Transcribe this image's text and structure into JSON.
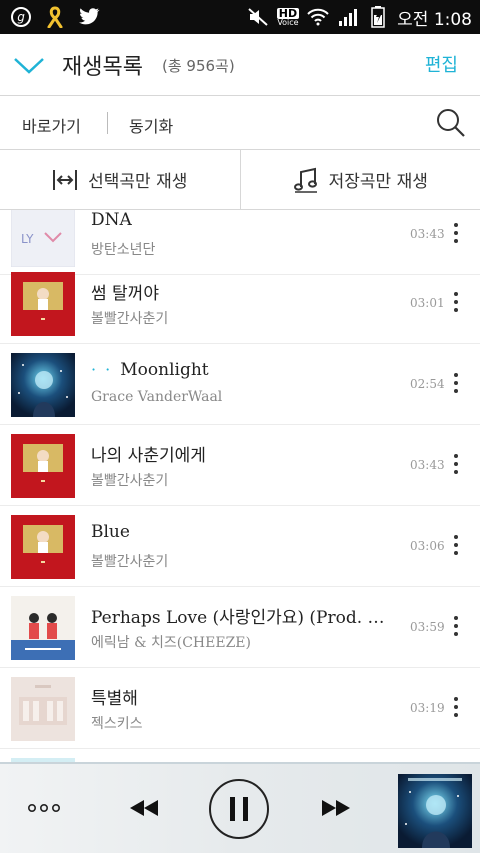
{
  "status_bar": {
    "icons": [
      "g-circle-icon",
      "yellow-ribbon-icon",
      "twitter-icon",
      "mute-icon",
      "hd-voice-icon",
      "wifi-icon",
      "signal-icon",
      "battery-icon"
    ],
    "hd": "HD",
    "voice": "Voice",
    "time": "오전 1:08"
  },
  "header": {
    "title": "재생목록",
    "count": "(총 956곡)",
    "edit": "편집"
  },
  "subbar": {
    "shortcut": "바로가기",
    "sync": "동기화"
  },
  "modes": {
    "selected_only": "선택곡만 재생",
    "saved_only": "저장곡만 재생"
  },
  "songs": [
    {
      "title": "DNA",
      "artist": "방탄소년단",
      "duration": "03:43",
      "art": "bts"
    },
    {
      "title": "썸 탈꺼야",
      "artist": "볼빨간사춘기",
      "duration": "03:01",
      "art": "bol"
    },
    {
      "title": "Moonlight",
      "artist": "Grace VanderWaal",
      "duration": "02:54",
      "art": "grace",
      "playing": true
    },
    {
      "title": "나의 사춘기에게",
      "artist": "볼빨간사춘기",
      "duration": "03:43",
      "art": "bol"
    },
    {
      "title": "Blue",
      "artist": "볼빨간사춘기",
      "duration": "03:06",
      "art": "bol"
    },
    {
      "title": "Perhaps Love (사랑인가요) (Prod. by ··",
      "artist": "에릭남 & 치즈(CHEEZE)",
      "duration": "03:59",
      "art": "perhaps"
    },
    {
      "title": "특별해",
      "artist": "젝스키스",
      "duration": "03:19",
      "art": "sechs"
    }
  ],
  "colors": {
    "accent": "#1fb3d6",
    "bol_red": "#c2161e",
    "bol_gold": "#d8b964"
  }
}
